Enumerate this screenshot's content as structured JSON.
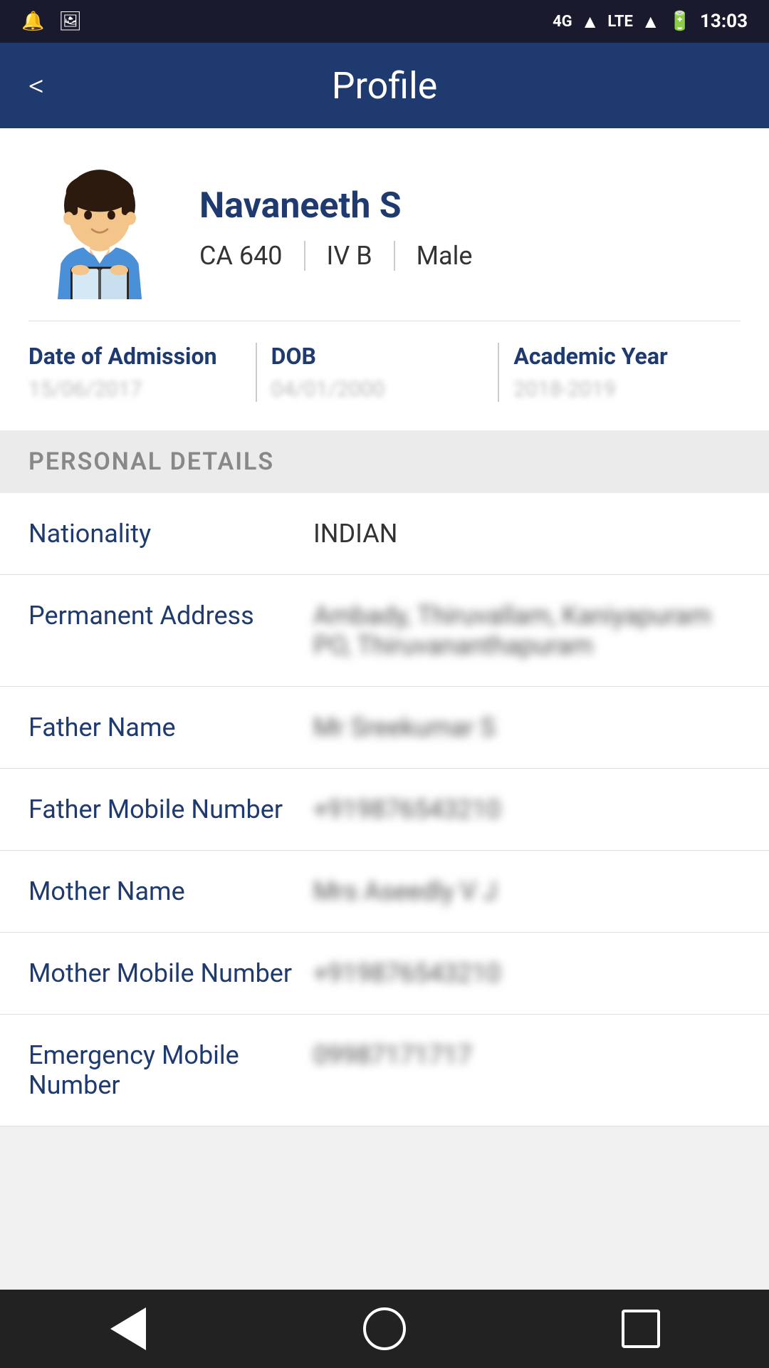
{
  "statusBar": {
    "time": "13:03",
    "network": "4G LTE"
  },
  "header": {
    "title": "Profile",
    "backLabel": "<"
  },
  "profile": {
    "name": "Navaneeth S",
    "rollNumber": "CA 640",
    "class": "IV B",
    "gender": "Male",
    "dateOfAdmissionLabel": "Date of Admission",
    "dateOfAdmissionValue": "15/06/2017",
    "dobLabel": "DOB",
    "dobValue": "04/01/2000",
    "academicYearLabel": "Academic Year",
    "academicYearValue": "2018-2019"
  },
  "personalDetails": {
    "sectionTitle": "PERSONAL DETAILS",
    "fields": [
      {
        "label": "Nationality",
        "value": "INDIAN",
        "blurred": false
      },
      {
        "label": "Permanent Address",
        "value": "Ambady, Thiruvallam, Kaniyapuram PO, Thiruvananthapuram",
        "blurred": true
      },
      {
        "label": "Father Name",
        "value": "Mr Sreekumar S",
        "blurred": true
      },
      {
        "label": "Father Mobile Number",
        "value": "+919876543210",
        "blurred": true
      },
      {
        "label": "Mother Name",
        "value": "Mrs Aseedly V J",
        "blurred": true
      },
      {
        "label": "Mother Mobile Number",
        "value": "+919876543210",
        "blurred": true
      },
      {
        "label": "Emergency Mobile Number",
        "value": "09987171717",
        "blurred": true
      }
    ]
  },
  "bottomNav": {
    "back": "back",
    "home": "home",
    "recents": "recents"
  }
}
